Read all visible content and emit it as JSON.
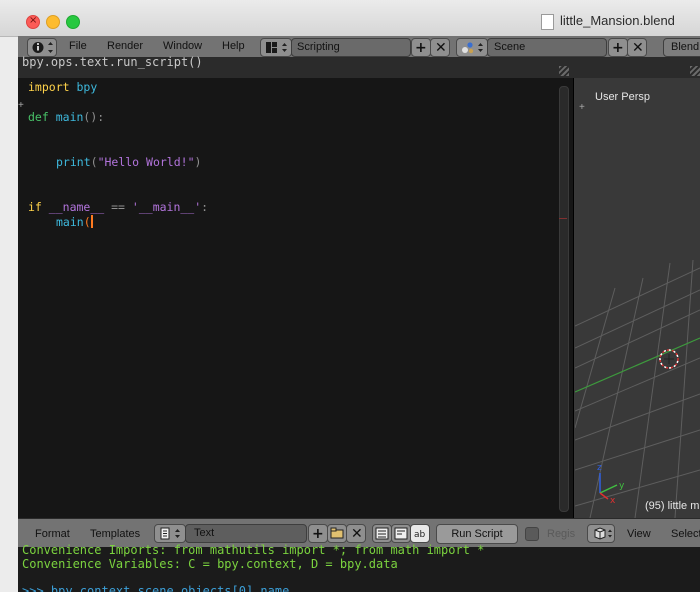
{
  "window": {
    "title": "little_Mansion.blend",
    "close_glyph": "×"
  },
  "menubar": {
    "items": [
      "File",
      "Render",
      "Window",
      "Help"
    ],
    "layout": "Scripting",
    "scene": "Scene",
    "engine": "Blend"
  },
  "text_editor": {
    "header_text": "bpy.ops.text.run_script()",
    "code": {
      "import_kw": "import",
      "import_mod": "bpy",
      "def_kw": "def",
      "def_name": "main",
      "def_rest": "():",
      "print_fn": "print",
      "print_open": "(",
      "print_str": "\"Hello World!\"",
      "print_close": ")",
      "if_kw": "if",
      "if_name": "__name__",
      "if_eq": "==",
      "if_str": "'__main__'",
      "if_colon": ":",
      "call_name": "main",
      "call_open": "("
    }
  },
  "viewport": {
    "label": "User Persp",
    "info": "(95) little m"
  },
  "bottom_header": {
    "format": "Format",
    "templates": "Templates",
    "text_name": "Text",
    "run_script": "Run Script",
    "register": "Regis",
    "view": "View",
    "select": "Select"
  },
  "console": {
    "line1": "Convenience Imports: from mathutils import *; from math import *",
    "line2": "Convenience Variables: C = bpy.context, D = bpy.data",
    "line3": ">>> bpy.context.scene.objects[0].name"
  }
}
